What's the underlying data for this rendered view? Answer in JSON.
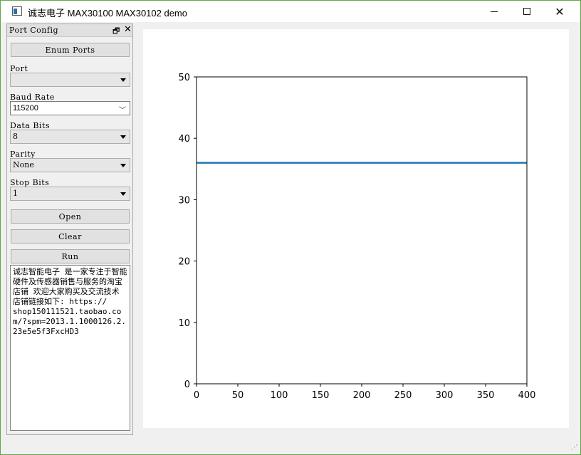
{
  "window": {
    "title": "诚志电子 MAX30100 MAX30102 demo",
    "minimize_label": "—",
    "maximize_label": "☐",
    "close_label": "✕"
  },
  "dock": {
    "title": "Port Config",
    "float_icon": "float-icon",
    "close_icon": "close-icon"
  },
  "controls": {
    "enum_ports_label": "Enum Ports",
    "port_label": "Port",
    "port_value": "",
    "baud_label": "Baud Rate",
    "baud_value": "115200",
    "data_bits_label": "Data Bits",
    "data_bits_value": "8",
    "parity_label": "Parity",
    "parity_value": "None",
    "stop_bits_label": "Stop Bits",
    "stop_bits_value": "1",
    "open_label": "Open",
    "clear_label": "Clear",
    "run_label": "Run"
  },
  "log_text": "诚志智能电子 是一家专注于智能硬件及传感器销售与服务的淘宝店铺 欢迎大家购买及交流技术  店铺链接如下: https://\nshop150111521.taobao.com/?spm=2013.1.1000126.2.23e5e5f3FxcHD3",
  "chart_data": {
    "type": "line",
    "title": "",
    "xlabel": "",
    "ylabel": "",
    "xlim": [
      0,
      400
    ],
    "ylim": [
      0,
      50
    ],
    "x_ticks": [
      0,
      50,
      100,
      150,
      200,
      250,
      300,
      350,
      400
    ],
    "y_ticks": [
      0,
      10,
      20,
      30,
      40,
      50
    ],
    "series": [
      {
        "x": [
          0,
          400
        ],
        "y": [
          36,
          36
        ],
        "color": "#1f77b4"
      }
    ],
    "grid": false
  }
}
